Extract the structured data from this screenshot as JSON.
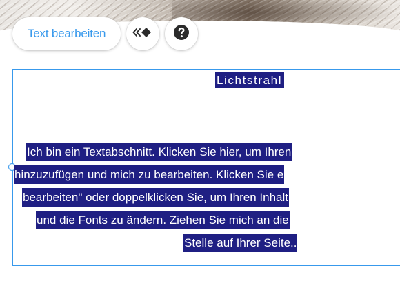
{
  "toolbar": {
    "edit_text_label": "Text bearbeiten",
    "animation_icon": "animation-icon",
    "help_icon": "help-icon",
    "accent_color": "#3899ec"
  },
  "text_box": {
    "title": "Lichtstrahl",
    "paragraph_lines": [
      "Ich bin ein Textabschnitt. Klicken Sie hier, um Ihren",
      "hinzuzufügen und mich zu bearbeiten. Klicken Sie e",
      "bearbeiten\" oder doppelklicken Sie, um Ihren Inhalt",
      "und die Fonts zu ändern. Ziehen Sie mich an die",
      "Stelle auf Ihrer Seite.."
    ],
    "selection_color": "#1f1f83",
    "border_color": "#3899ec"
  }
}
